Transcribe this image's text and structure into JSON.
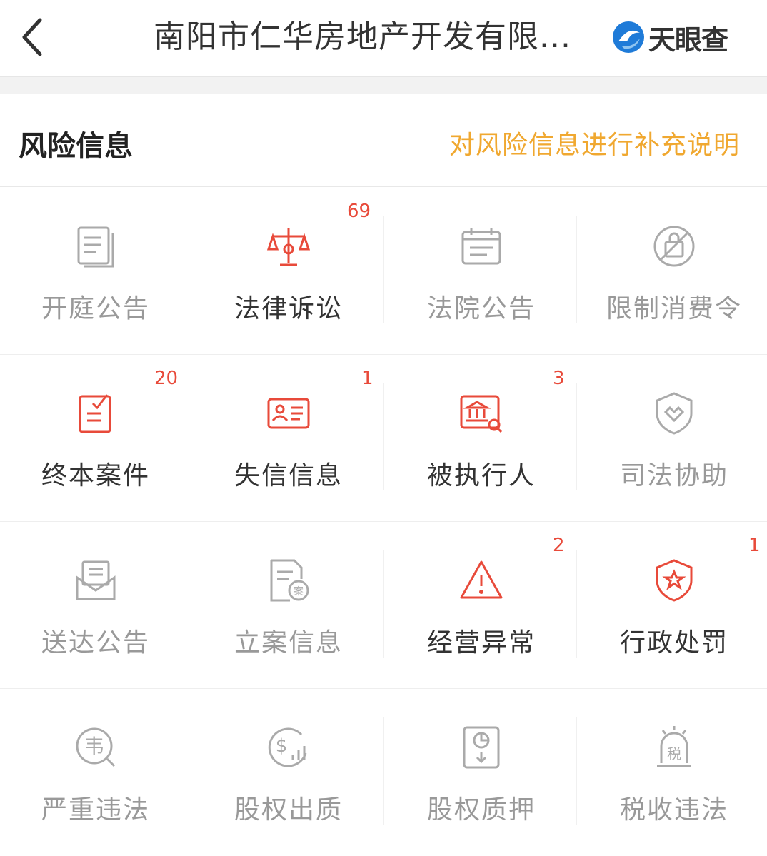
{
  "header": {
    "title": "南阳市仁华房地产开发有限...",
    "brand": "天眼查"
  },
  "section": {
    "title": "风险信息",
    "link": "对风险信息进行补充说明"
  },
  "colors": {
    "accent_red": "#e84a3a",
    "link_orange": "#f0a830",
    "inactive_gray": "#999999"
  },
  "items": [
    {
      "label": "开庭公告",
      "badge": "",
      "icon": "document-list-icon",
      "active": false
    },
    {
      "label": "法律诉讼",
      "badge": "69",
      "icon": "scales-icon",
      "active": true
    },
    {
      "label": "法院公告",
      "badge": "",
      "icon": "calendar-notice-icon",
      "active": false
    },
    {
      "label": "限制消费令",
      "badge": "",
      "icon": "no-shopping-icon",
      "active": false
    },
    {
      "label": "终本案件",
      "badge": "20",
      "icon": "clipboard-check-icon",
      "active": true
    },
    {
      "label": "失信信息",
      "badge": "1",
      "icon": "id-card-icon",
      "active": true
    },
    {
      "label": "被执行人",
      "badge": "3",
      "icon": "court-search-icon",
      "active": true
    },
    {
      "label": "司法协助",
      "badge": "",
      "icon": "shield-heart-icon",
      "active": false
    },
    {
      "label": "送达公告",
      "badge": "",
      "icon": "envelope-icon",
      "active": false
    },
    {
      "label": "立案信息",
      "badge": "",
      "icon": "case-file-icon",
      "active": false
    },
    {
      "label": "经营异常",
      "badge": "2",
      "icon": "warning-icon",
      "active": true
    },
    {
      "label": "行政处罚",
      "badge": "1",
      "icon": "badge-star-icon",
      "active": true
    },
    {
      "label": "严重违法",
      "badge": "",
      "icon": "violation-search-icon",
      "active": false
    },
    {
      "label": "股权出质",
      "badge": "",
      "icon": "dollar-chart-icon",
      "active": false
    },
    {
      "label": "股权质押",
      "badge": "",
      "icon": "pie-download-icon",
      "active": false
    },
    {
      "label": "税收违法",
      "badge": "",
      "icon": "tax-alarm-icon",
      "active": false
    }
  ]
}
